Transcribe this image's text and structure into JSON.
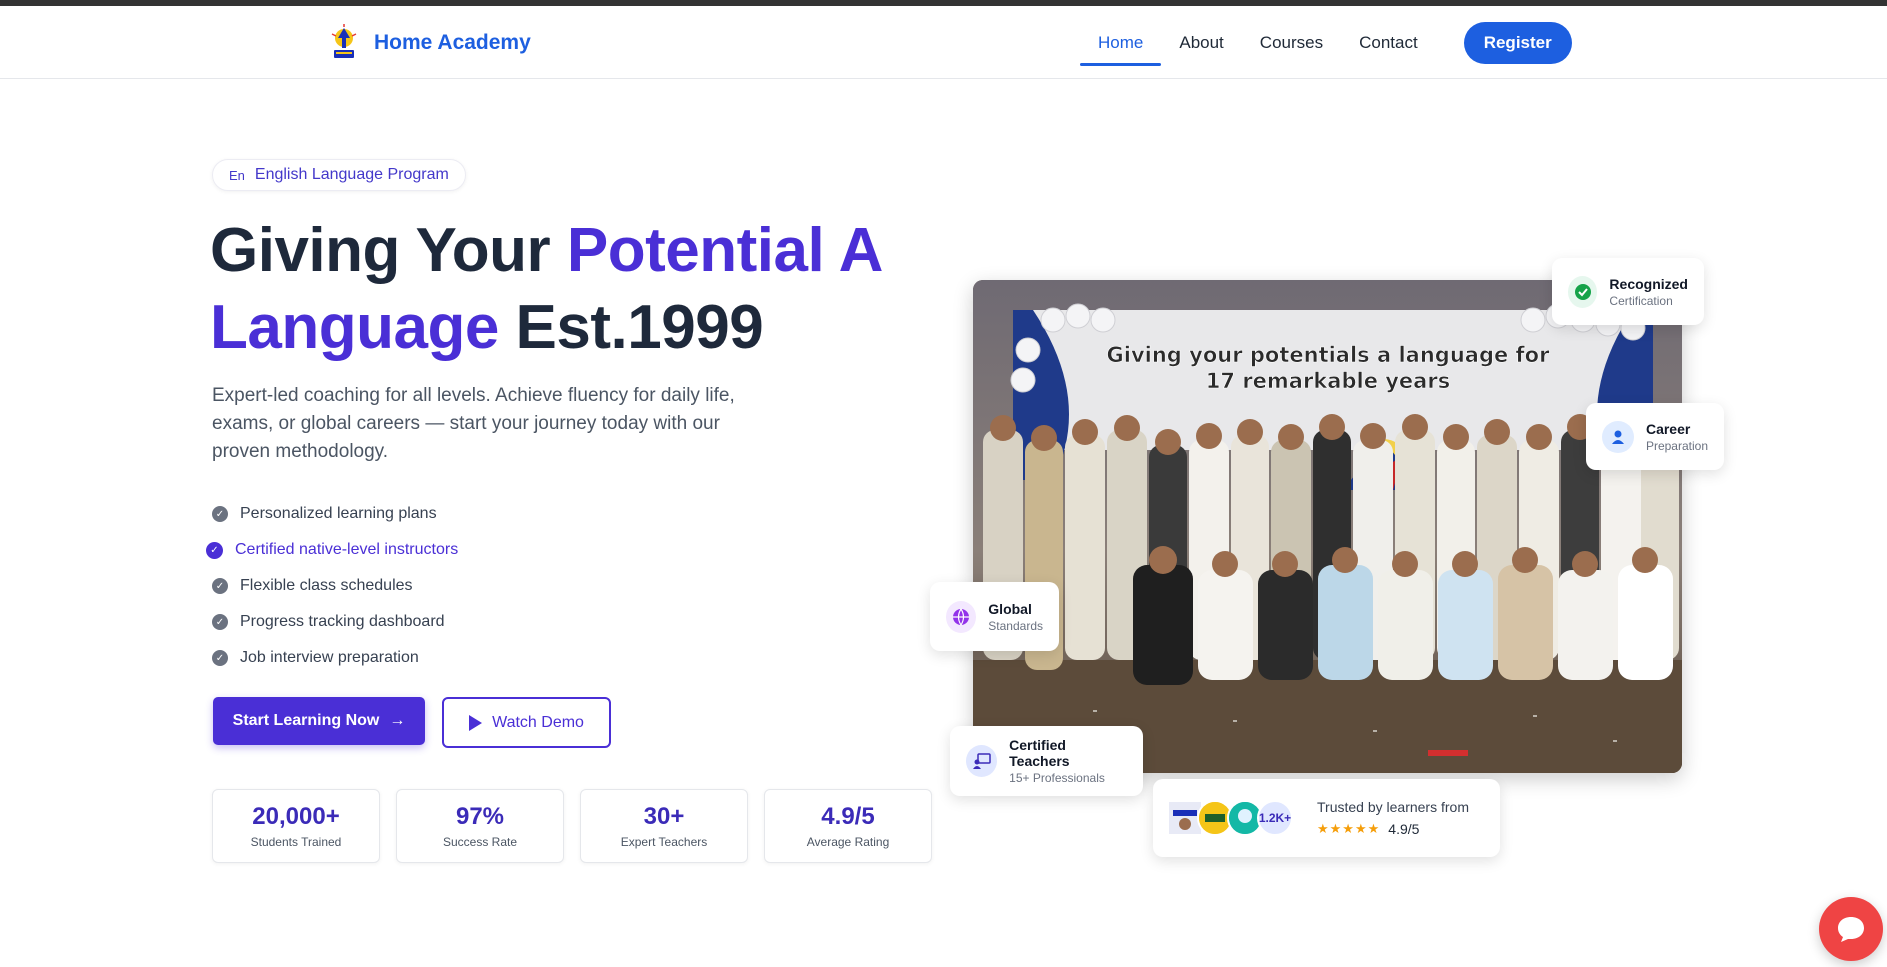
{
  "brand": {
    "name": "Home Academy"
  },
  "nav": {
    "links": [
      {
        "label": "Home",
        "active": true
      },
      {
        "label": "About"
      },
      {
        "label": "Courses"
      },
      {
        "label": "Contact"
      }
    ],
    "register_label": "Register"
  },
  "hero": {
    "pill": {
      "icon_text": "En",
      "label": "English Language Program"
    },
    "headline": {
      "part1": "Giving Your ",
      "accent": "Potential A Language",
      "part2": " Est.1999"
    },
    "lede": "Expert-led coaching for all levels. Achieve fluency for daily life, exams, or global careers — start your journey today with our proven methodology.",
    "features": [
      "Personalized learning plans",
      "Certified native-level instructors",
      "Flexible class schedules",
      "Progress tracking dashboard",
      "Job interview preparation"
    ],
    "highlighted_feature_index": 1,
    "cta_primary": "Start Learning Now",
    "cta_secondary": "Watch Demo",
    "stats": [
      {
        "value": "20,000+",
        "label": "Students Trained"
      },
      {
        "value": "97%",
        "label": "Success Rate"
      },
      {
        "value": "30+",
        "label": "Expert Teachers"
      },
      {
        "value": "4.9/5",
        "label": "Average Rating"
      }
    ]
  },
  "photo": {
    "banner_line1": "Giving your potentials a language for",
    "banner_line2": "17 remarkable years"
  },
  "cards": {
    "recognized": {
      "title": "Recognized",
      "sub": "Certification"
    },
    "career": {
      "title": "Career",
      "sub": "Preparation"
    },
    "global": {
      "title": "Global",
      "sub": "Standards"
    },
    "teachers": {
      "title": "Certified Teachers",
      "sub": "15+ Professionals"
    }
  },
  "trusted": {
    "count": "1.2K+",
    "label": "Trusted by learners from",
    "stars": "★★★★★",
    "rating": "4.9/5"
  },
  "colors": {
    "brand_blue": "#1d5fe0",
    "accent_purple": "#4a2fd6",
    "chat_red": "#ef4444"
  }
}
